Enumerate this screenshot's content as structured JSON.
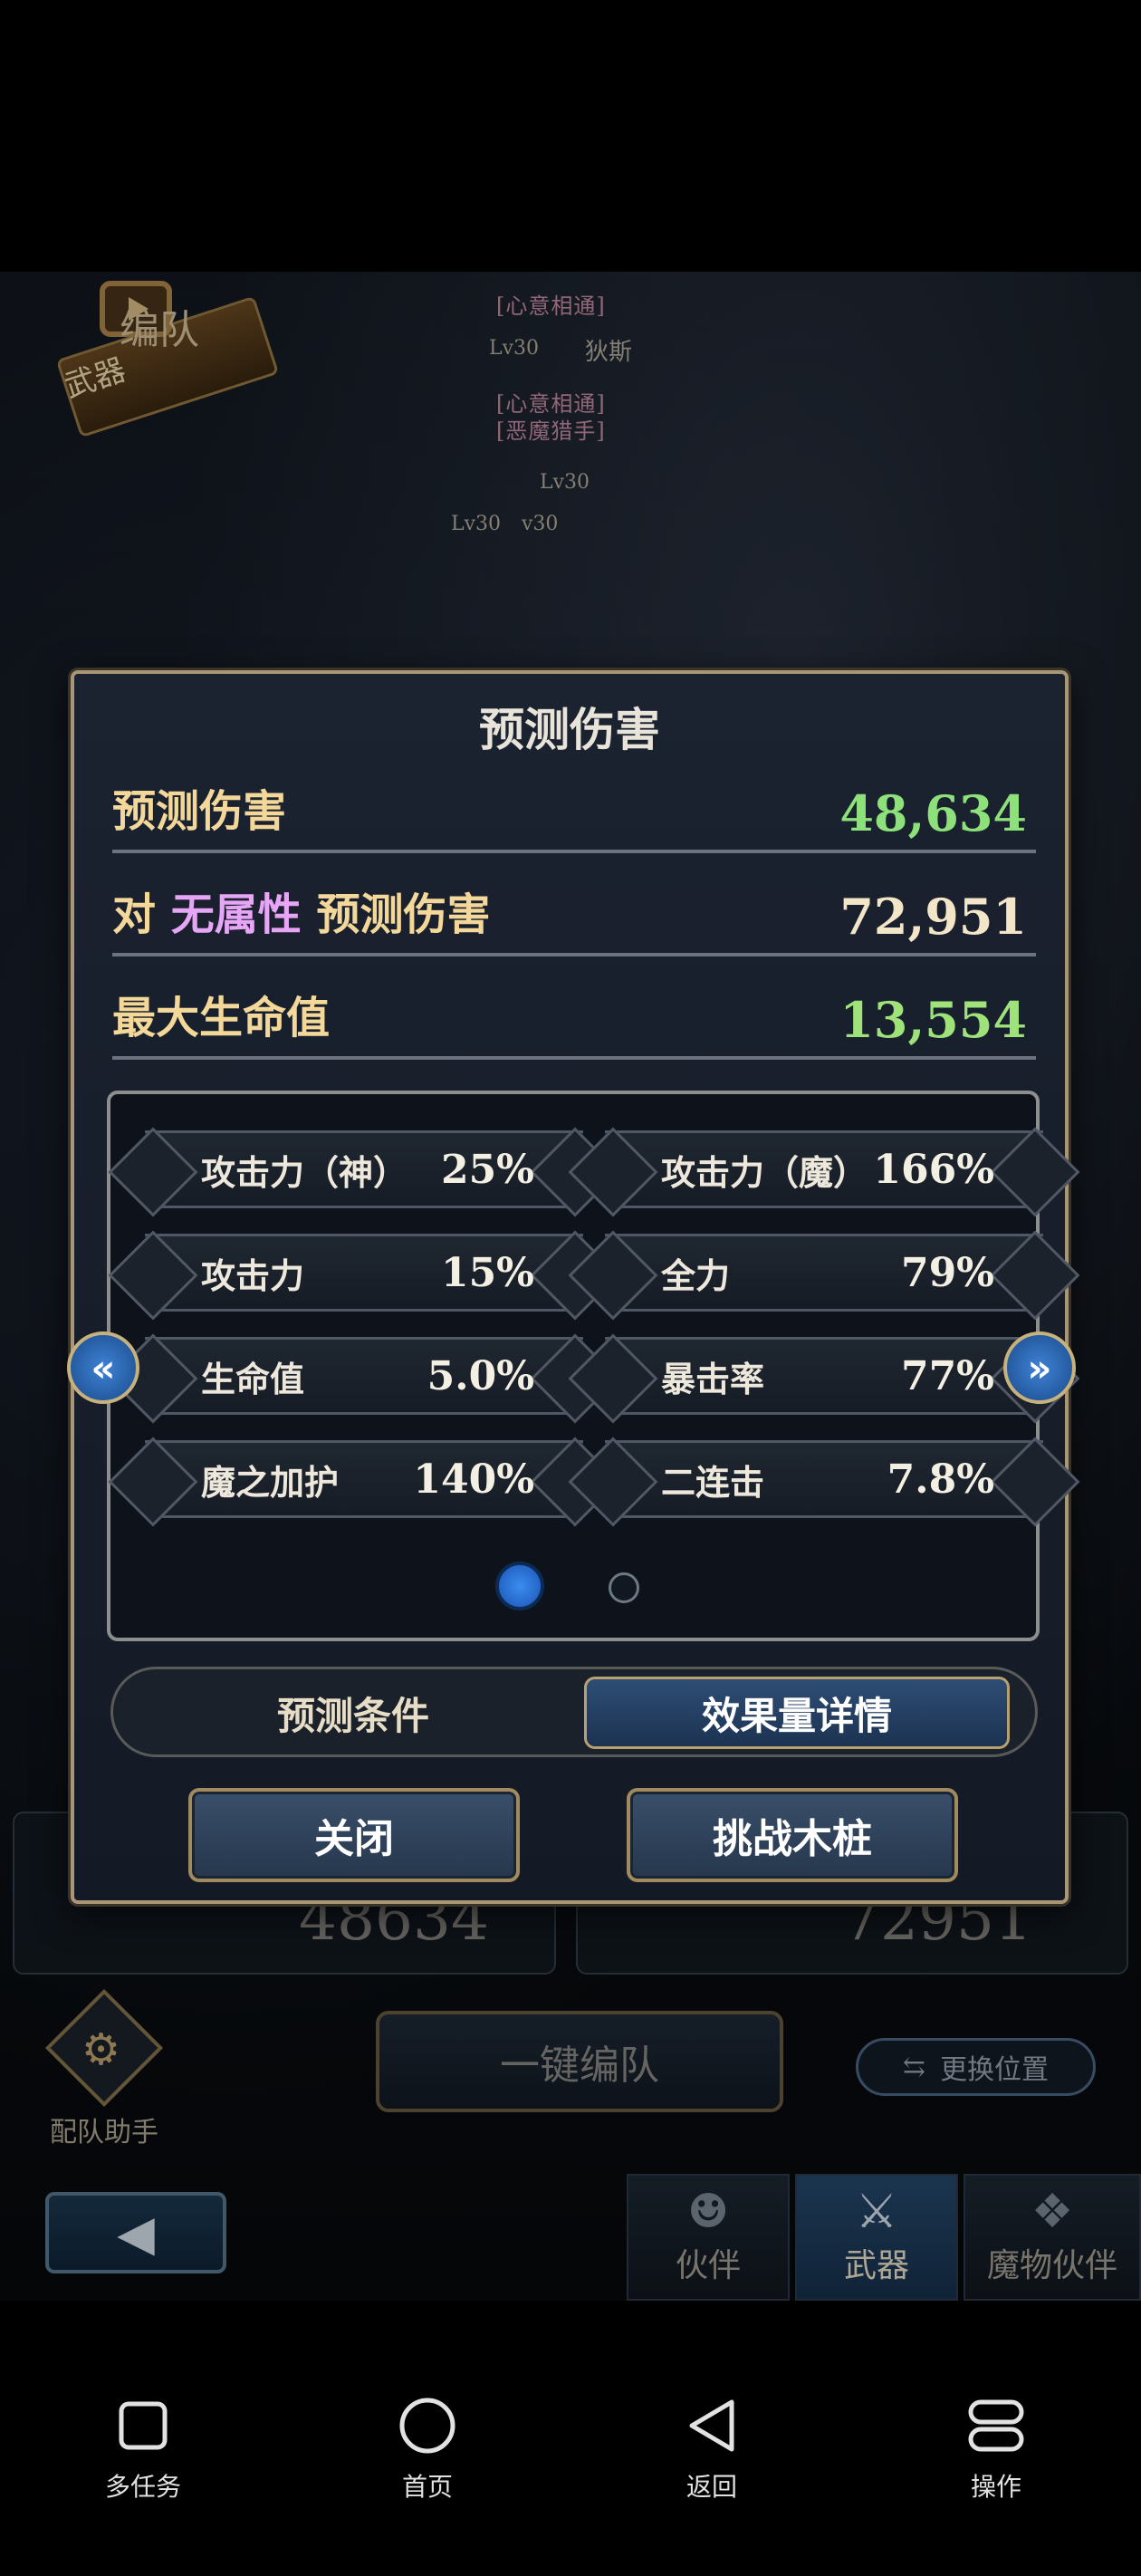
{
  "game": {
    "team_title": "编队",
    "weapon_label": "武器",
    "bg_tags": [
      "[心意相通]",
      "[心意相通]",
      "[恶魔猎手]"
    ],
    "bg_levels": [
      "Lv30",
      "Lv30",
      "Lv30",
      "v30"
    ],
    "bg_name": "狄斯",
    "bg_numbers": [
      "48634",
      "72951"
    ],
    "assistant_label": "配队助手",
    "auto_team_label": "一键编队",
    "swap_label": "更换位置",
    "bottom_tabs": [
      "伙伴",
      "武器",
      "魔物伙伴"
    ]
  },
  "modal": {
    "title": "预测伤害",
    "summary": {
      "predicted_label": "预测伤害",
      "predicted_value": "48,634",
      "vs_prefix": "对",
      "vs_element": "无属性",
      "vs_suffix": "预测伤害",
      "vs_value": "72,951",
      "hp_label": "最大生命值",
      "hp_value": "13,554"
    },
    "stats": [
      {
        "name": "攻击力（神）",
        "value": "25%"
      },
      {
        "name": "攻击力（魔）",
        "value": "166%"
      },
      {
        "name": "攻击力",
        "value": "15%"
      },
      {
        "name": "全力",
        "value": "79%"
      },
      {
        "name": "生命值",
        "value": "5.0%"
      },
      {
        "name": "暴击率",
        "value": "77%"
      },
      {
        "name": "魔之加护",
        "value": "140%"
      },
      {
        "name": "二连击",
        "value": "7.8%"
      }
    ],
    "page_indicator": {
      "current": 1,
      "total": 2
    },
    "tabs": {
      "conditions": "预测条件",
      "details": "效果量详情",
      "active": "details"
    },
    "close_label": "关闭",
    "challenge_label": "挑战木桩",
    "prev_arrow": "«",
    "next_arrow": "»"
  },
  "android_nav": {
    "recents": "多任务",
    "home": "首页",
    "back": "返回",
    "menu": "操作"
  },
  "colors": {
    "positive_value": "#8ee07a",
    "neutral_value": "#f3d89a",
    "element_accent": "#e6a6f5",
    "gold_border": "#a89676",
    "active_dot": "#2d7ae0"
  },
  "icons": {
    "prev": "double-chevron-left-icon",
    "next": "double-chevron-right-icon",
    "recents": "square-icon",
    "home": "circle-icon",
    "back": "triangle-back-icon",
    "menu": "stacked-pills-icon"
  }
}
